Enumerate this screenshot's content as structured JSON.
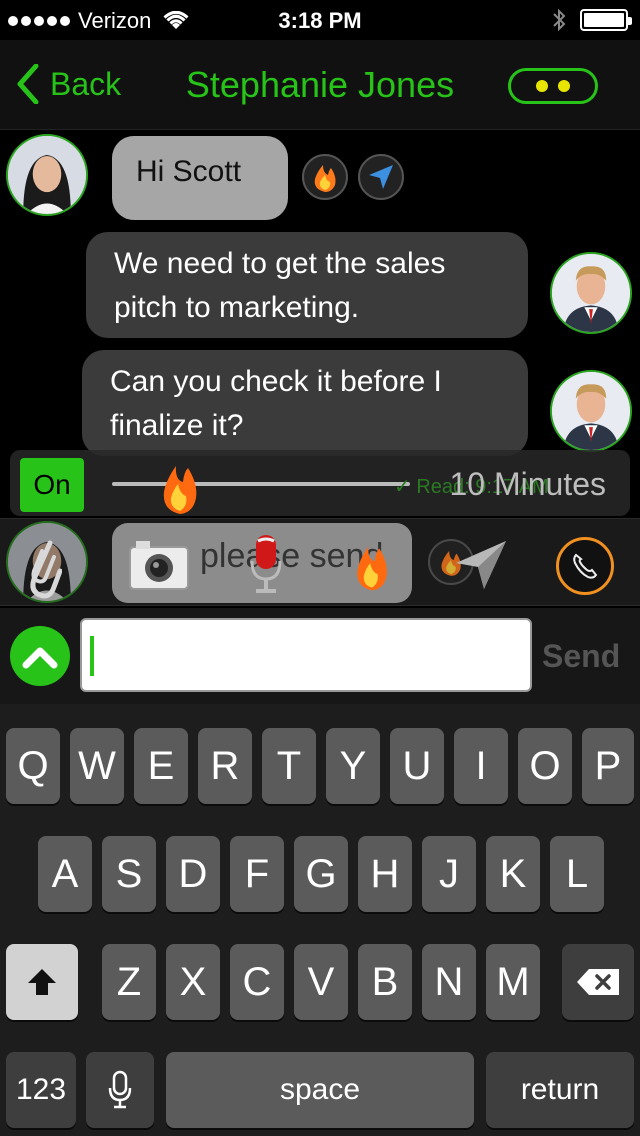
{
  "status_bar": {
    "carrier": "Verizon",
    "time": "3:18 PM",
    "signal_icon": "signal-dots-icon",
    "wifi_icon": "wifi-icon",
    "bluetooth_icon": "bluetooth-icon",
    "battery_icon": "battery-icon",
    "battery_level": 1.0
  },
  "nav": {
    "back_label": "Back",
    "title": "Stephanie Jones",
    "accent_color": "#27c318"
  },
  "messages": [
    {
      "sender": "Stephanie Jones",
      "side": "left",
      "text": "Hi Scott"
    },
    {
      "sender": "Scott",
      "side": "right",
      "text_lines": [
        "We need to get the sales",
        "pitch to marketing."
      ]
    },
    {
      "sender": "Scott",
      "side": "right",
      "text_lines": [
        "Can you check it before I",
        "finalize it?"
      ]
    }
  ],
  "timer": {
    "toggle_label": "On",
    "read_receipt": "✓ Read: 9:17 AM",
    "duration_label": "10 Minutes",
    "slider_level": 0.22
  },
  "compose_preview": {
    "text": "please send",
    "icons": [
      "paperclip-icon",
      "camera-icon",
      "microphone-icon",
      "flame-icon",
      "send-arrow-icon",
      "phone-icon"
    ]
  },
  "input": {
    "value": "",
    "send_label": "Send"
  },
  "keyboard": {
    "row1": [
      "Q",
      "W",
      "E",
      "R",
      "T",
      "Y",
      "U",
      "I",
      "O",
      "P"
    ],
    "row2": [
      "A",
      "S",
      "D",
      "F",
      "G",
      "H",
      "J",
      "K",
      "L"
    ],
    "row3": [
      "Z",
      "X",
      "C",
      "V",
      "B",
      "N",
      "M"
    ],
    "numbers_label": "123",
    "space_label": "space",
    "return_label": "return"
  }
}
